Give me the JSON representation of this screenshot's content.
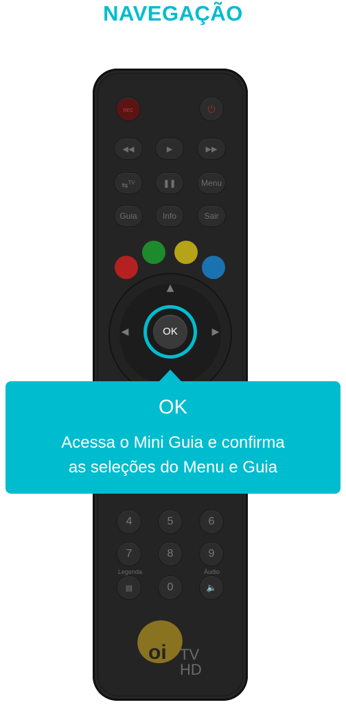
{
  "header": {
    "title": "NAVEGAÇÃO"
  },
  "remote": {
    "rec_label": "REC",
    "menu_label": "Menu",
    "guia_label": "Guia",
    "info_label": "Info",
    "sair_label": "Sair",
    "tv_label": "TV",
    "ok_label": "OK",
    "numbers": [
      "4",
      "5",
      "6",
      "7",
      "8",
      "9",
      "0"
    ],
    "legenda_label": "Legenda",
    "audio_label": "Áudio",
    "colors": {
      "red": "#b52020",
      "green": "#1e8a2e",
      "yellow": "#b5a318",
      "blue": "#1a73b0"
    }
  },
  "tooltip": {
    "title": "OK",
    "line1": "Acessa o Mini Guia e confirma",
    "line2": "as seleções do Menu e Guia",
    "color": "#00bccf"
  },
  "logo": {
    "brand": "oi",
    "tv": "TV",
    "hd": "HD"
  }
}
